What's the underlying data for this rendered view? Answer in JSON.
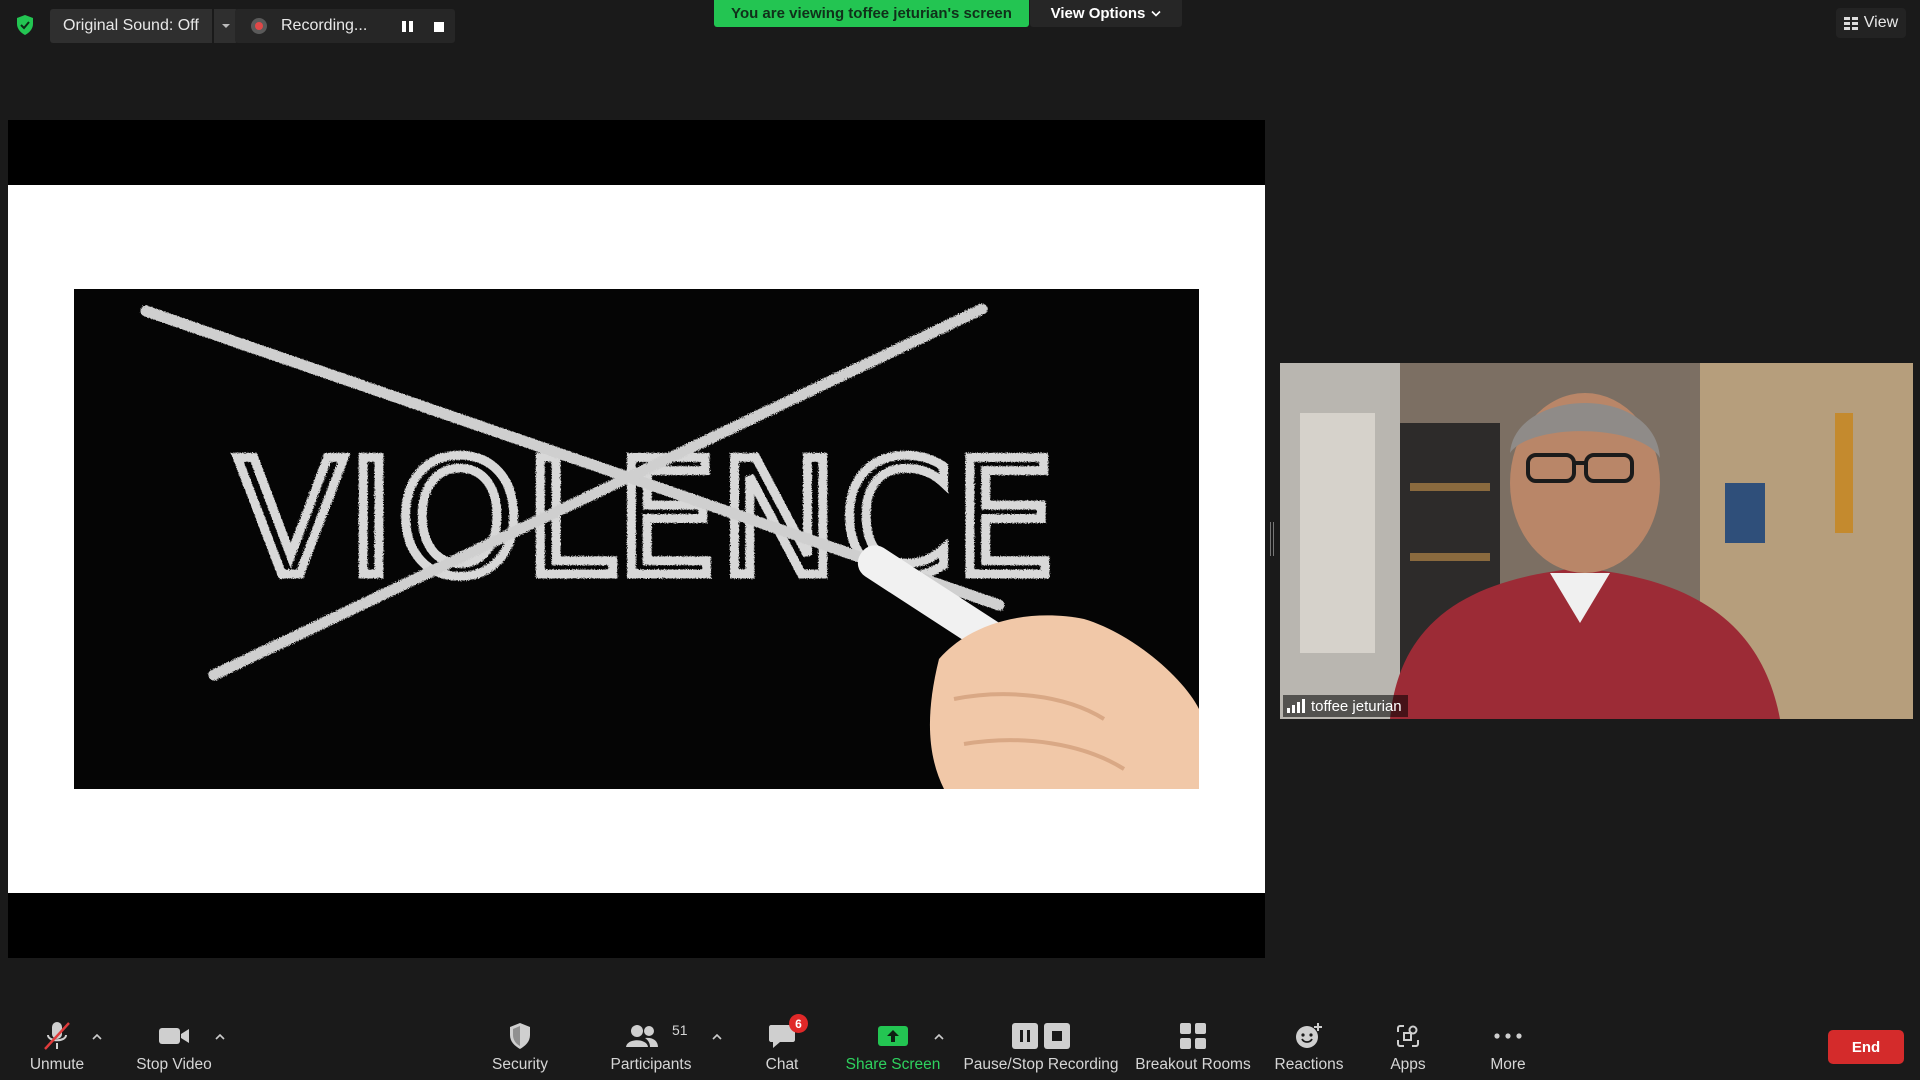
{
  "topbar": {
    "original_sound_label": "Original Sound: Off",
    "recording_label": "Recording...",
    "viewing_banner": "You are viewing toffee jeturian's screen",
    "view_options_label": "View Options",
    "view_label": "View"
  },
  "share": {
    "slide_word": "VIOLENCE"
  },
  "video": {
    "participant_name": "toffee jeturian"
  },
  "toolbar": {
    "unmute": "Unmute",
    "stop_video": "Stop Video",
    "security": "Security",
    "participants": "Participants",
    "participants_count": "51",
    "chat": "Chat",
    "chat_badge": "6",
    "share_screen": "Share Screen",
    "pause_stop_recording": "Pause/Stop Recording",
    "breakout_rooms": "Breakout Rooms",
    "reactions": "Reactions",
    "apps": "Apps",
    "more": "More",
    "end": "End"
  },
  "colors": {
    "background": "#1a1a1a",
    "banner_green": "#23c552",
    "share_green": "#2ed15e",
    "end_red": "#d42b2b",
    "badge_red": "#e02828"
  }
}
